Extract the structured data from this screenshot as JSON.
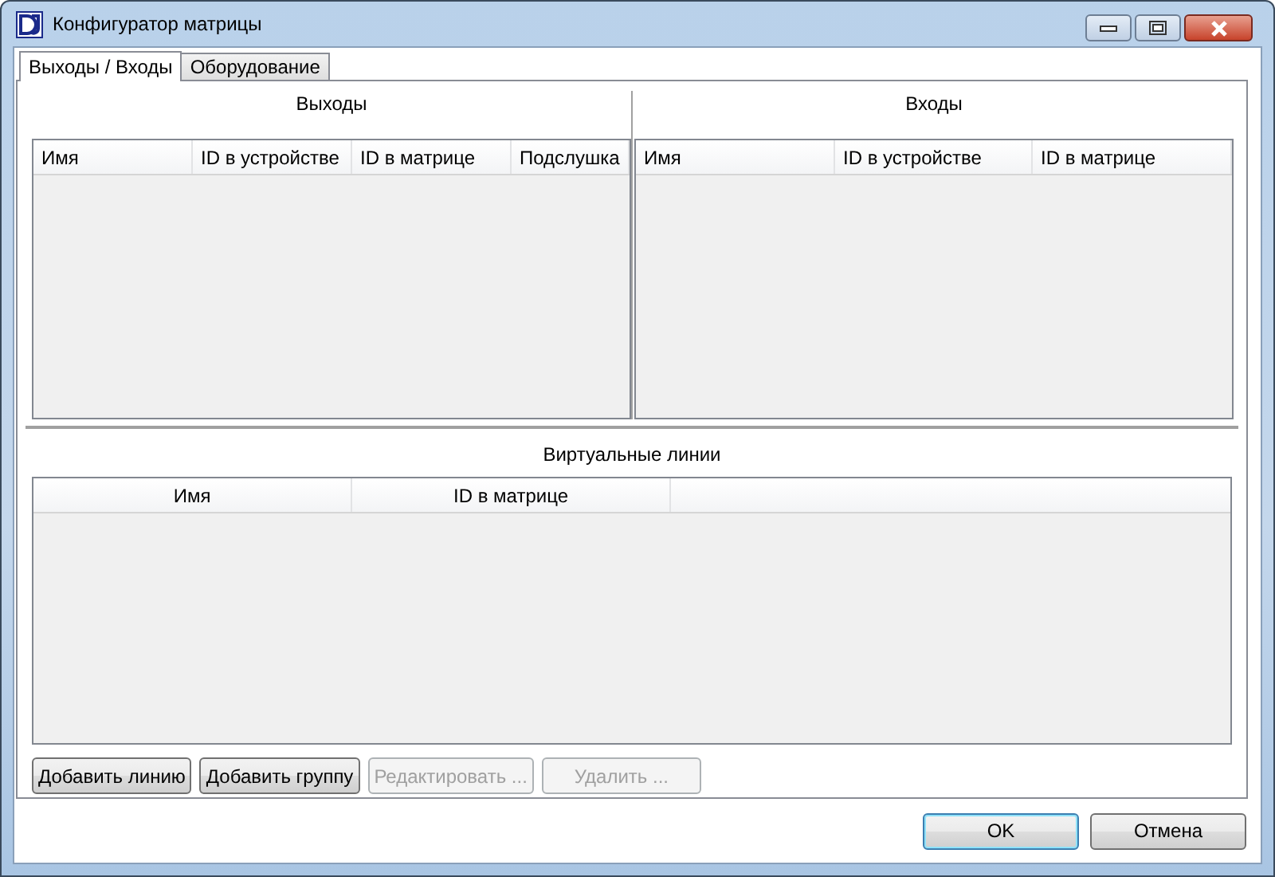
{
  "window": {
    "title": "Конфигуратор матрицы"
  },
  "tabs": [
    {
      "label": "Выходы / Входы",
      "selected": true
    },
    {
      "label": "Оборудование",
      "selected": false
    }
  ],
  "outputs": {
    "title": "Выходы",
    "columns": [
      "Имя",
      "ID в устройстве",
      "ID в матрице",
      "Подслушка"
    ]
  },
  "inputs": {
    "title": "Входы",
    "columns": [
      "Имя",
      "ID в устройстве",
      "ID в матрице"
    ]
  },
  "virtual_lines": {
    "title": "Виртуальные линии",
    "columns": [
      "Имя",
      "ID в матрице"
    ]
  },
  "actions": [
    {
      "label": "Добавить линию",
      "disabled": false
    },
    {
      "label": "Добавить группу",
      "disabled": false
    },
    {
      "label": "Редактировать ...",
      "disabled": true
    },
    {
      "label": "Удалить ...",
      "disabled": true
    }
  ],
  "dialog_buttons": [
    {
      "label": "OK",
      "default": true
    },
    {
      "label": "Отмена",
      "default": false
    }
  ]
}
